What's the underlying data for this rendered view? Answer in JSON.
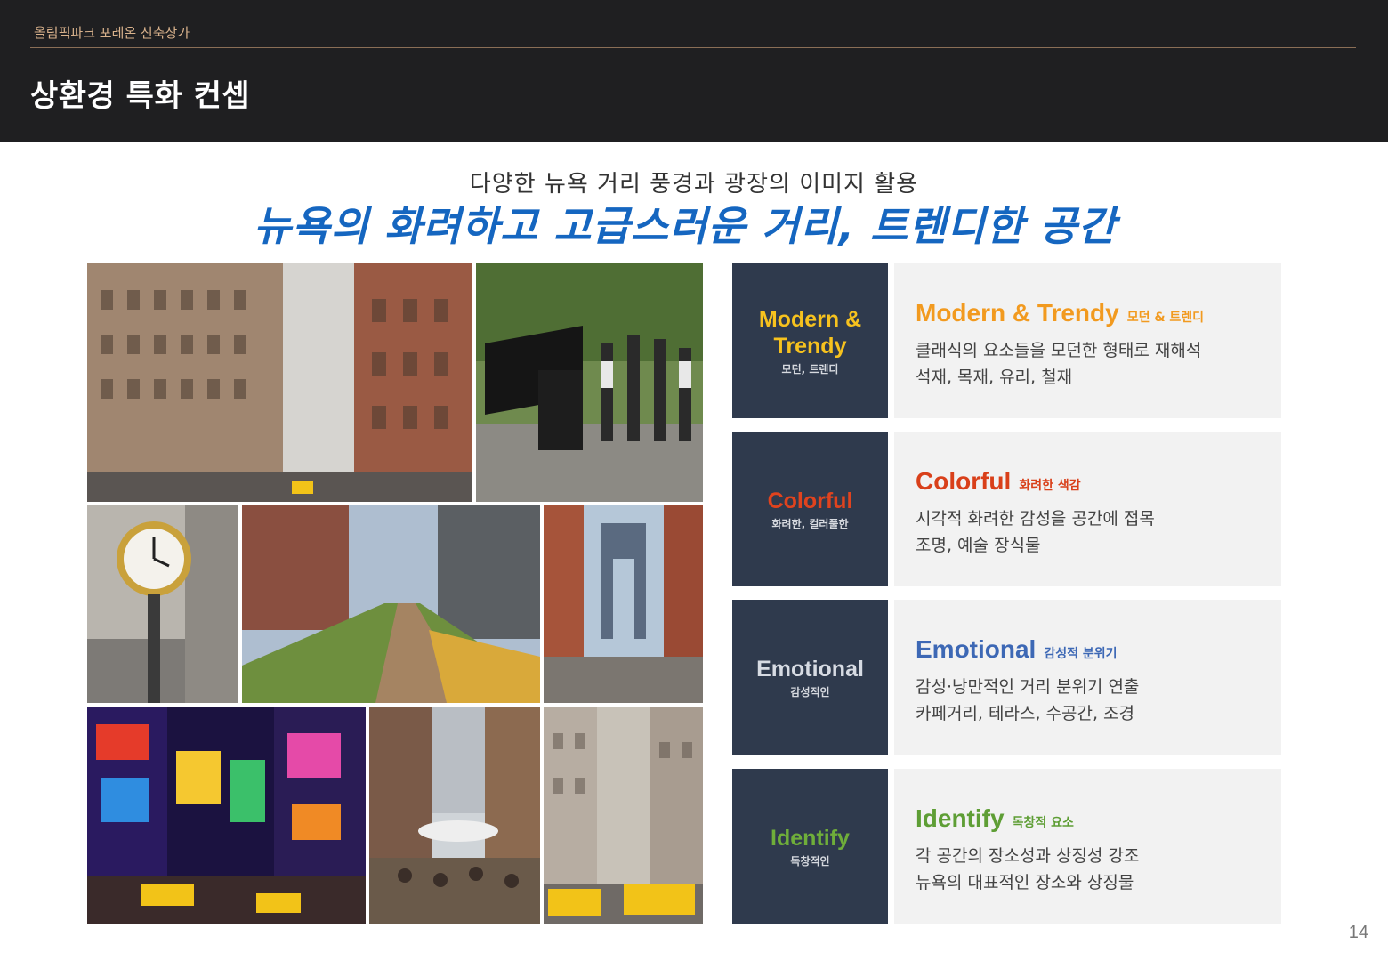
{
  "header": {
    "project": "올림픽파크 포레온 신축상가",
    "title": "상환경 특화 컨셉"
  },
  "intro": {
    "subhead": "다양한 뉴욕 거리 풍경과 광장의 이미지 활용",
    "headline": "뉴욕의 화려하고 고급스러운 거리, 트렌디한 공간"
  },
  "concepts": [
    {
      "label_en": "Modern &\nTrendy",
      "label_ko": "모던, 트렌디",
      "title_en": "Modern & Trendy",
      "title_ko": "모던 & 트렌디",
      "lines": [
        "클래식의 요소들을 모던한 형태로 재해석",
        "석재, 목재, 유리, 철재"
      ],
      "color": "#f29a1f"
    },
    {
      "label_en": "Colorful",
      "label_ko": "화려한, 컬러풀한",
      "title_en": "Colorful",
      "title_ko": "화려한 색감",
      "lines": [
        "시각적 화려한 감성을 공간에 접목",
        "조명, 예술 장식물"
      ],
      "color": "#d9401a"
    },
    {
      "label_en": "Emotional",
      "label_ko": "감성적인",
      "title_en": "Emotional",
      "title_ko": "감성적 분위기",
      "lines": [
        "감성·낭만적인 거리 분위기 연출",
        "카페거리, 테라스, 수공간, 조경"
      ],
      "color": "#3d68b5"
    },
    {
      "label_en": "Identify",
      "label_ko": "독창적인",
      "title_en": "Identify",
      "title_ko": "독창적 요소",
      "lines": [
        "각 공간의 장소성과 상징성 강조",
        "뉴욕의 대표적인 장소와 상징물"
      ],
      "color": "#5e9e35"
    }
  ],
  "label_colors": [
    "#f7c21e",
    "#e0431e",
    "#d7dbe3",
    "#6fae3a"
  ],
  "page_number": "14"
}
